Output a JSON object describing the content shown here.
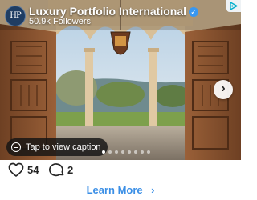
{
  "account": {
    "avatar_text": "HP",
    "name": "Luxury Portfolio International",
    "followers": "50.9k Followers",
    "verified": true
  },
  "post": {
    "image_subject": "arched doorway opening onto a terrace with columns and a hanging lantern",
    "caption_button": "Tap to view caption",
    "carousel": {
      "total": 8,
      "active_index": 0
    }
  },
  "engagement": {
    "likes": "54",
    "comments": "2"
  },
  "cta": {
    "label": "Learn More",
    "chevron": "›"
  },
  "icons": {
    "next": "chevron-right-icon",
    "caption": "caption-icon",
    "like": "heart-icon",
    "comment": "comment-icon",
    "adchoices": "adchoices-icon"
  },
  "colors": {
    "cta": "#3b8fe6",
    "verified": "#3897f0",
    "text": "#262626"
  }
}
